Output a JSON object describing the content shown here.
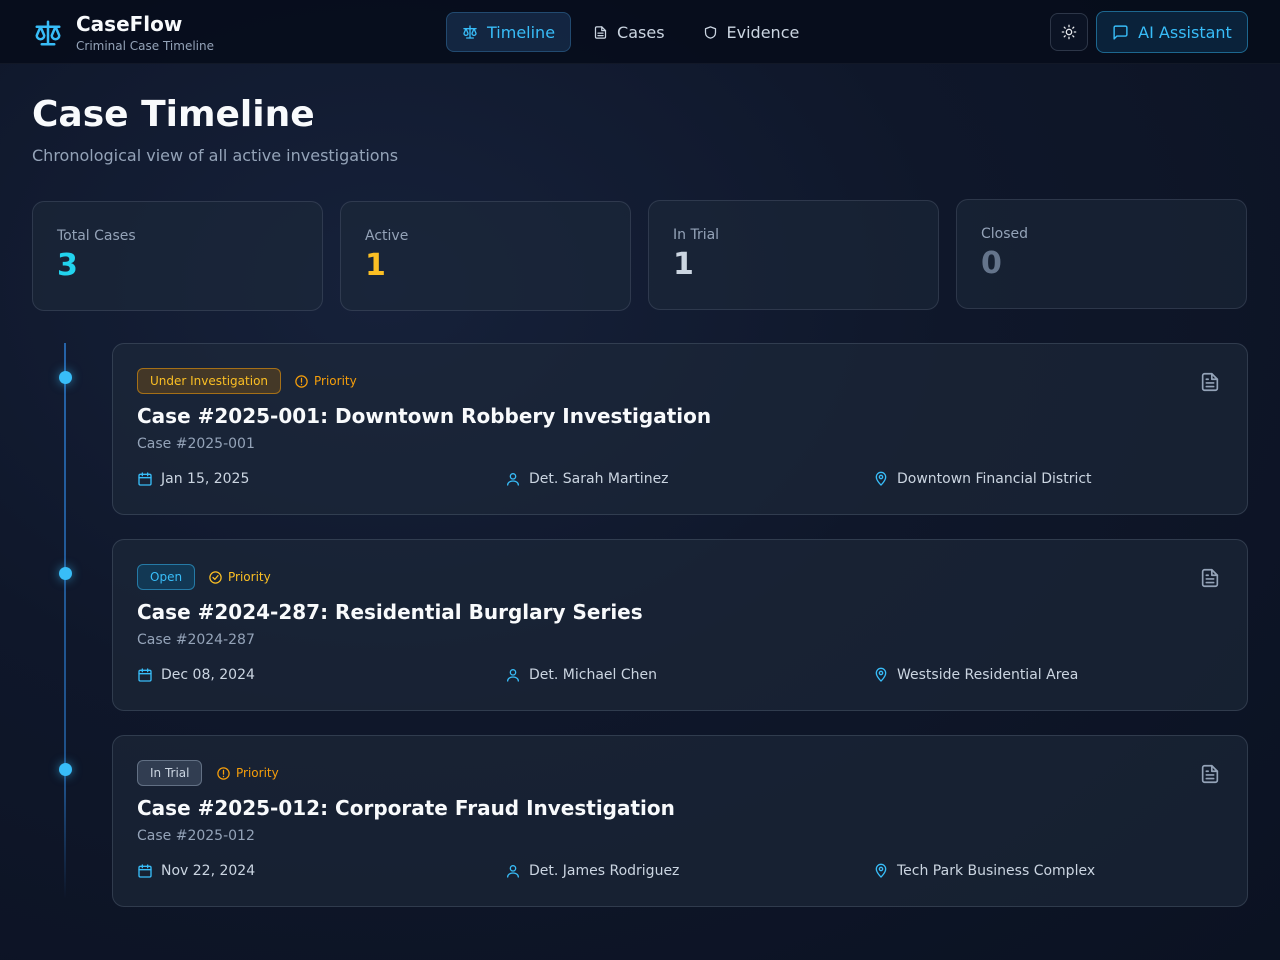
{
  "brand": {
    "name": "CaseFlow",
    "subtitle": "Criminal Case Timeline"
  },
  "nav": [
    {
      "label": "Timeline",
      "icon": "scale-icon",
      "active": true
    },
    {
      "label": "Cases",
      "icon": "file-icon",
      "active": false
    },
    {
      "label": "Evidence",
      "icon": "shield-icon",
      "active": false
    }
  ],
  "header": {
    "ai_button": "AI Assistant"
  },
  "page": {
    "title": "Case Timeline",
    "subtitle": "Chronological view of all active investigations"
  },
  "stats": [
    {
      "label": "Total Cases",
      "value": "3",
      "color": "#22d3ee"
    },
    {
      "label": "Active",
      "value": "1",
      "color": "#fbbf24"
    },
    {
      "label": "In Trial",
      "value": "1",
      "color": "#cbd5e1"
    },
    {
      "label": "Closed",
      "value": "0",
      "color": "#64748b"
    }
  ],
  "cases": [
    {
      "status": "Under Investigation",
      "priority": "Priority",
      "title": "Case #2025-001: Downtown Robbery Investigation",
      "case_number": "Case #2025-001",
      "date": "Jan 15, 2025",
      "detective": "Det. Sarah Martinez",
      "location": "Downtown Financial District"
    },
    {
      "status": "Open",
      "priority": "Priority",
      "title": "Case #2024-287: Residential Burglary Series",
      "case_number": "Case #2024-287",
      "date": "Dec 08, 2024",
      "detective": "Det. Michael Chen",
      "location": "Westside Residential Area"
    },
    {
      "status": "In Trial",
      "priority": "Priority",
      "title": "Case #2025-012: Corporate Fraud Investigation",
      "case_number": "Case #2025-012",
      "date": "Nov 22, 2024",
      "detective": "Det. James Rodriguez",
      "location": "Tech Park Business Complex"
    }
  ],
  "colors": {
    "accent": "#38bdf8",
    "warning": "#f59e0b",
    "background": "#0f172a"
  }
}
